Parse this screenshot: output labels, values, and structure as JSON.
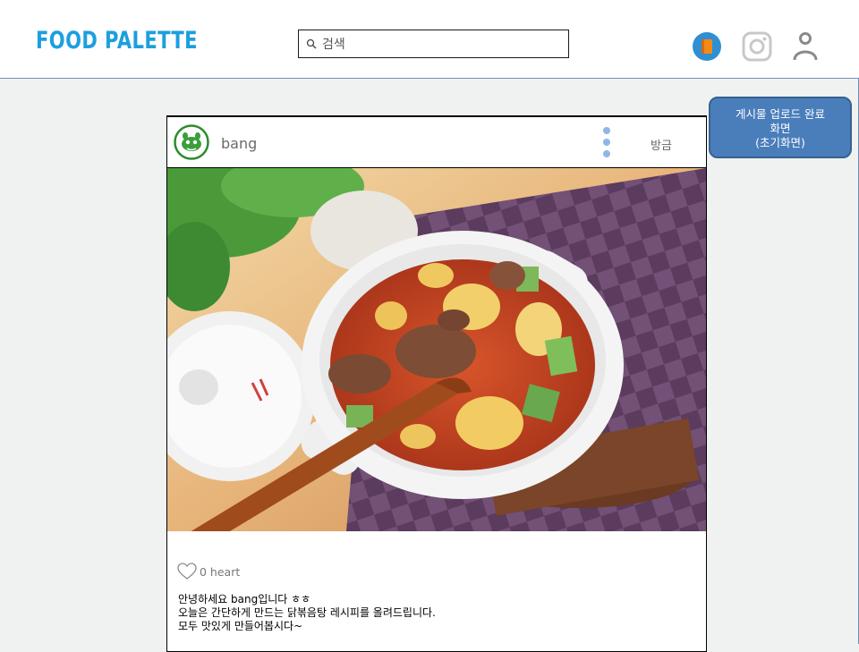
{
  "header": {
    "logo": "FOOD PALETTE",
    "search": {
      "placeholder": "검색",
      "value": ""
    },
    "icons": [
      "book-icon",
      "instagram-icon",
      "user-icon"
    ]
  },
  "post": {
    "username": "bang",
    "time": "방금",
    "photo": "food-photo",
    "likes": "0 heart",
    "caption": [
      "안녕하세요 bang입니다 ㅎㅎ",
      "오늘은 간단하게 만드는 닭볶음탕 레시피를 올려드립니다.",
      "모두 맛있게 만들어봅시다~"
    ]
  },
  "annotation": {
    "lines": [
      "게시물 업로드 완료",
      "화면",
      "(초기화면)"
    ]
  },
  "colors": {
    "brand": "#1c9fde",
    "note_bg": "#4a7ebb",
    "note_border": "#36628f"
  }
}
